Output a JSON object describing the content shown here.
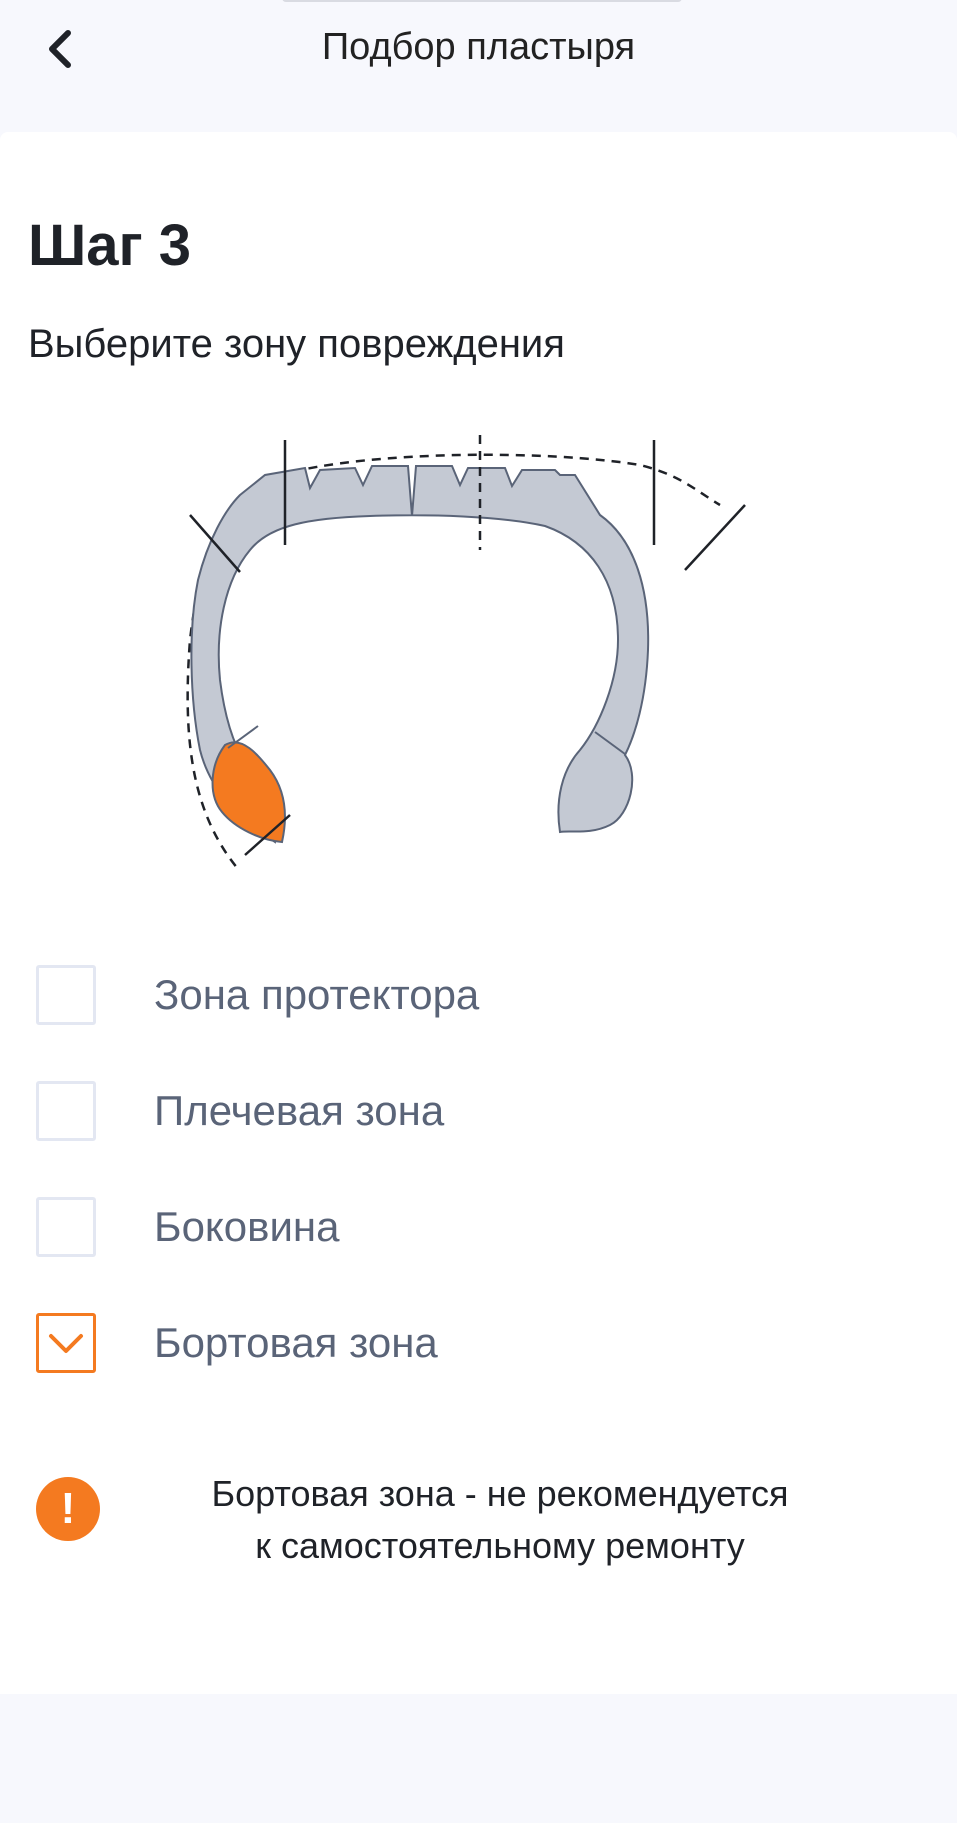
{
  "header": {
    "title": "Подбор пластыря",
    "back_icon": "chevron-left-icon"
  },
  "step": {
    "title": "Шаг 3",
    "subtitle": "Выберите зону повреждения"
  },
  "options": [
    {
      "label": "Зона протектора",
      "checked": false
    },
    {
      "label": "Плечевая зона",
      "checked": false
    },
    {
      "label": "Боковина",
      "checked": false
    },
    {
      "label": "Бортовая зона",
      "checked": true
    }
  ],
  "warning": {
    "icon": "exclamation-icon",
    "line1": "Бортовая зона - не рекомендуется",
    "line2": "к самостоятельному ремонту"
  },
  "colors": {
    "accent": "#f47a20",
    "tire_fill": "#c4c9d3",
    "text_primary": "#1f2228",
    "text_secondary": "#5a6478"
  }
}
